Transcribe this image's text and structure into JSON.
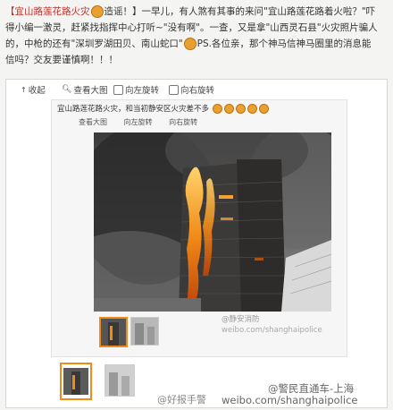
{
  "post": {
    "line1_a": "【宜山路莲花路火灾",
    "line1_b": "造谣！】一早儿，有人煞有其事的来问\"宜山路莲花路着火啦？\"吓",
    "line2": "得小编一激灵，赶紧找指挥中心打听~\"没有啊\"。一查，又是拿\"山西灵石县\"火灾照片骗人",
    "line3_a": "的，中枪的还有\"深圳罗湖田贝、南山蛇口\"",
    "line3_b": "PS.各位亲，那个神马信神马圈里的消息能",
    "line4": "信吗？交友要谨慎啊！！！"
  },
  "toolbar": {
    "collapse": "收起",
    "view_large": "查看大图",
    "rotate_left": "向左旋转",
    "rotate_right": "向右旋转"
  },
  "inner": {
    "caption": "宜山路莲花路火灾，和当初静安区火灾差不多",
    "view_large": "查看大图",
    "rotate_left": "向左旋转",
    "rotate_right": "向右旋转",
    "watermark1": "@静安消防",
    "watermark2": "weibo.com/shanghaipolice"
  },
  "watermarks": {
    "bottom_left": "@好报手警",
    "bottom_right_top": "@警民直通车-上海",
    "bottom_right": "weibo.com/shanghaipolice"
  },
  "colors": {
    "red": "#c0302a",
    "fire": "#f08a18"
  }
}
